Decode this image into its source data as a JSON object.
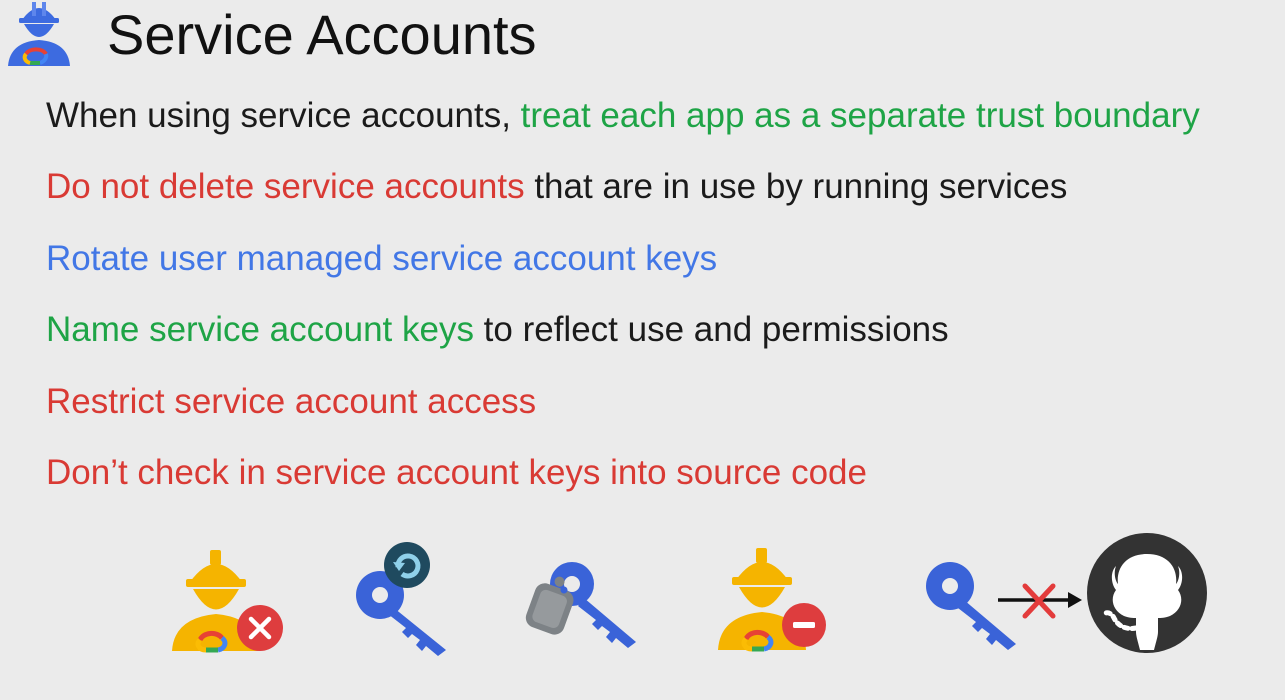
{
  "slide": {
    "title": "Service Accounts",
    "header_icon": "service-account-worker-icon"
  },
  "bullets": [
    {
      "parts": [
        {
          "text": "When using service accounts, ",
          "color": "#1b1b1b"
        },
        {
          "text": "treat each app as a separate trust boundary",
          "color": "#1ea446"
        }
      ]
    },
    {
      "parts": [
        {
          "text": "Do not delete service accounts",
          "color": "#d93a34"
        },
        {
          "text": " that are in use by running services",
          "color": "#1b1b1b"
        }
      ]
    },
    {
      "parts": [
        {
          "text": "Rotate user managed service account keys",
          "color": "#4277e6"
        }
      ]
    },
    {
      "parts": [
        {
          "text": "Name service account keys",
          "color": "#1ea446"
        },
        {
          "text": " to reflect use and permissions",
          "color": "#1b1b1b"
        }
      ]
    },
    {
      "parts": [
        {
          "text": "Restrict service account access",
          "color": "#d93a34"
        }
      ]
    },
    {
      "parts": [
        {
          "text": "Don’t check in service account keys into source code",
          "color": "#d93a34"
        }
      ]
    }
  ],
  "icons": [
    "service-account-delete-icon",
    "key-rotate-icon",
    "key-tag-icon",
    "service-account-restrict-icon",
    "key-no-commit-icon",
    "github-icon"
  ],
  "colors": {
    "background": "#ebebeb",
    "green": "#1ea446",
    "red": "#d93a34",
    "blue": "#4277e6",
    "worker_orange": "#f5b400",
    "key_blue": "#3a63d8"
  }
}
